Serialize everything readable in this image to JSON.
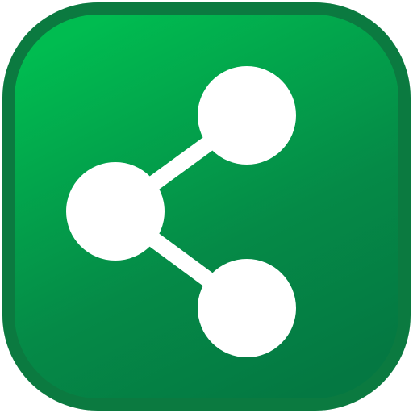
{
  "icon": {
    "name": "share-icon",
    "colors": {
      "frame": "#0B7A40",
      "gradient_top": "#00BC50",
      "gradient_bottom": "#047842",
      "glyph": "#FFFFFF"
    }
  }
}
